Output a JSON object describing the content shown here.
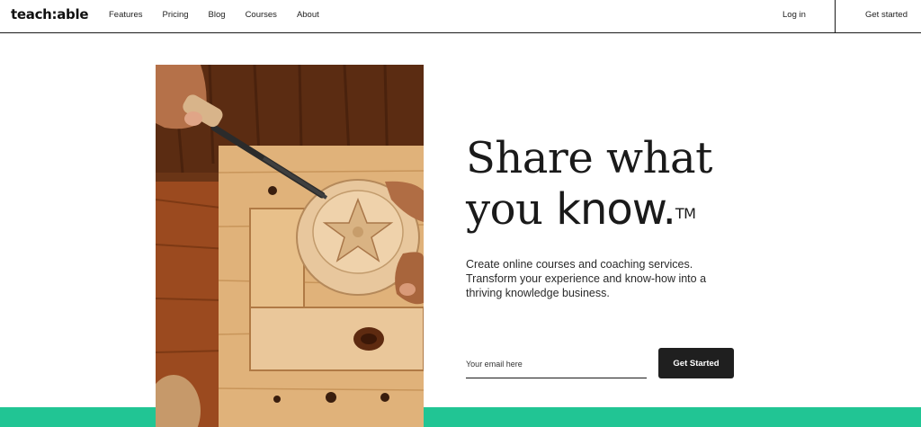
{
  "header": {
    "logo": "teach:able",
    "nav": [
      "Features",
      "Pricing",
      "Blog",
      "Courses",
      "About"
    ],
    "login": "Log in",
    "get_started": "Get started"
  },
  "hero": {
    "headline_line1": "Share what",
    "headline_line2_light": "you ",
    "headline_line2_bold": "know.",
    "trademark": "TM",
    "subtext": "Create online courses and coaching services. Transform your experience and know-how into a thriving knowledge business.",
    "email_placeholder": "Your email here",
    "cta_label": "Get Started"
  },
  "colors": {
    "accent": "#21c594",
    "cta_bg": "#1f1f1f",
    "text": "#1a1a1a"
  },
  "image": {
    "subject": "hands carving a wooden bowl with a chisel on a workbench",
    "icon": "photo-image"
  }
}
